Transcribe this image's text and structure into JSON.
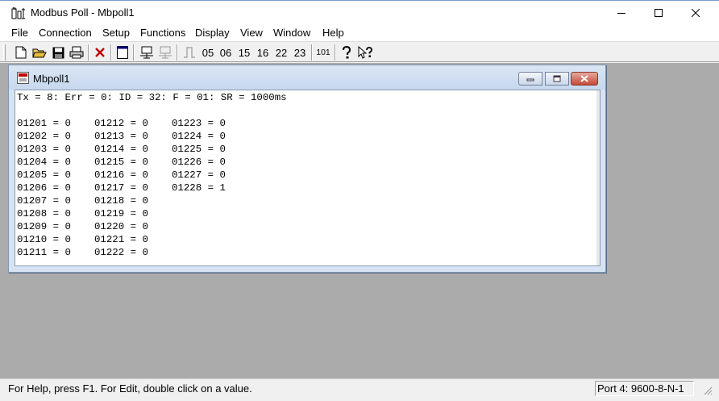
{
  "window": {
    "title": "Modbus Poll - Mbpoll1",
    "controls": {
      "minimize": "minimize-icon",
      "maximize": "maximize-icon",
      "close": "close-icon"
    }
  },
  "menu": {
    "items": [
      "File",
      "Connection",
      "Setup",
      "Functions",
      "Display",
      "View",
      "Window",
      "Help"
    ]
  },
  "toolbar": {
    "icons": [
      "new-document-icon",
      "open-folder-icon",
      "save-disk-icon",
      "print-icon",
      "delete-x-icon",
      "window-icon",
      "connect-icon",
      "disconnect-icon",
      "pulse-icon"
    ],
    "function_codes": [
      "05",
      "06",
      "15",
      "16",
      "22",
      "23"
    ],
    "counter_label": "101",
    "help_icons": [
      "help-icon",
      "context-help-icon"
    ]
  },
  "child": {
    "title": "Mbpoll1",
    "status_line": "Tx = 8: Err = 0: ID = 32: F = 01: SR = 1000ms",
    "columns": [
      [
        "01201 = 0",
        "01202 = 0",
        "01203 = 0",
        "01204 = 0",
        "01205 = 0",
        "01206 = 0",
        "01207 = 0",
        "01208 = 0",
        "01209 = 0",
        "01210 = 0",
        "01211 = 0"
      ],
      [
        "01212 = 0",
        "01213 = 0",
        "01214 = 0",
        "01215 = 0",
        "01216 = 0",
        "01217 = 0",
        "01218 = 0",
        "01219 = 0",
        "01220 = 0",
        "01221 = 0",
        "01222 = 0"
      ],
      [
        "01223 = 0",
        "01224 = 0",
        "01225 = 0",
        "01226 = 0",
        "01227 = 0",
        "01228 = 1"
      ]
    ]
  },
  "statusbar": {
    "help_text": "For Help, press F1.  For Edit, double click on a value.",
    "port": "Port 4: 9600-8-N-1"
  }
}
